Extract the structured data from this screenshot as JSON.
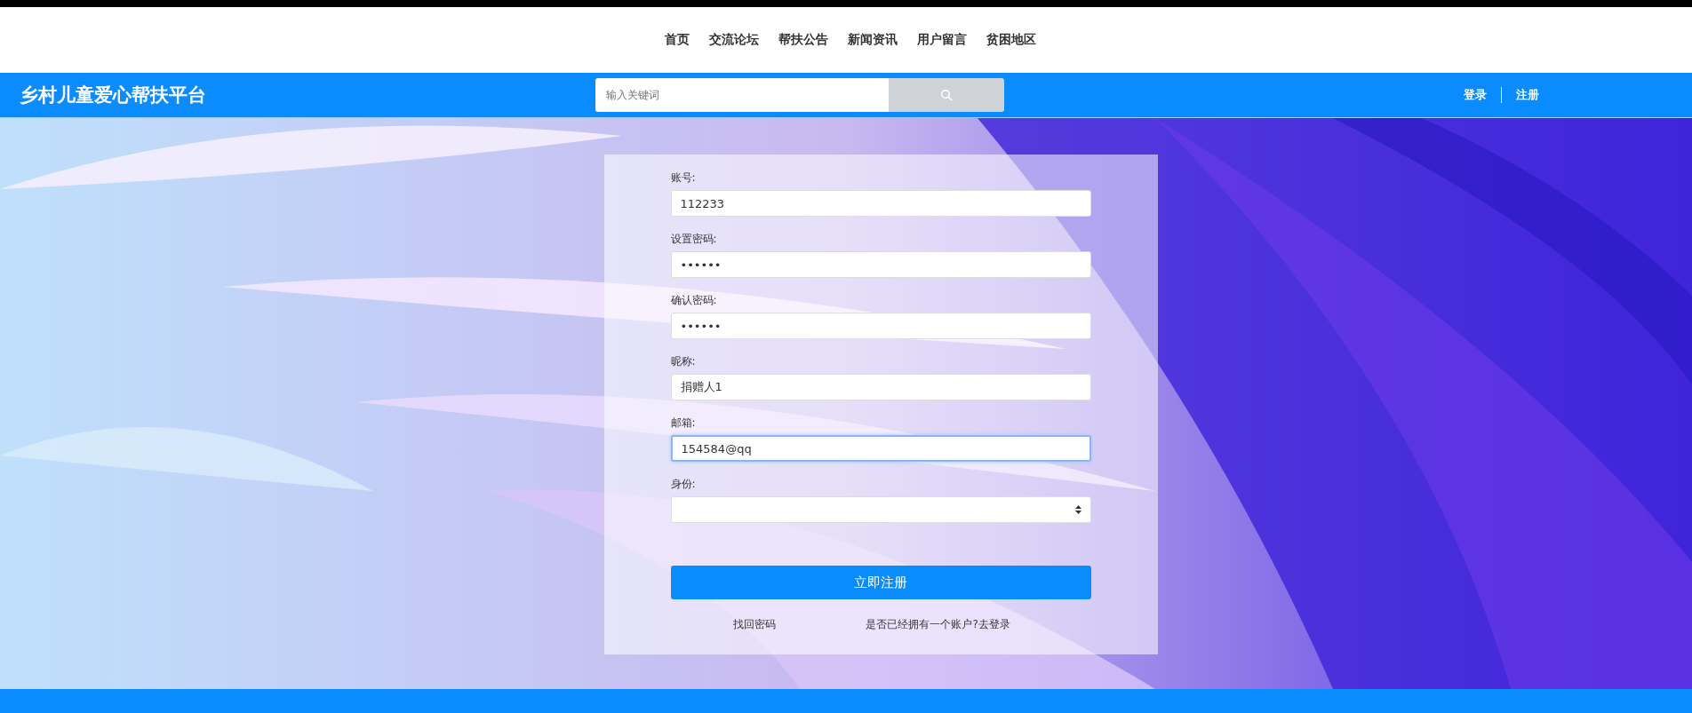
{
  "nav": [
    {
      "label": "首页"
    },
    {
      "label": "交流论坛"
    },
    {
      "label": "帮扶公告"
    },
    {
      "label": "新闻资讯"
    },
    {
      "label": "用户留言"
    },
    {
      "label": "贫困地区"
    }
  ],
  "header": {
    "title": "乡村儿童爱心帮扶平台",
    "search": {
      "placeholder": "输入关键词"
    },
    "links": [
      {
        "label": "登录"
      },
      {
        "label": "注册"
      }
    ]
  },
  "form": {
    "fields": [
      {
        "kind": "text",
        "label": "账号:",
        "value": "112233",
        "focused": false
      },
      {
        "kind": "text",
        "label": "设置密码:",
        "value": "••••••",
        "focused": false
      },
      {
        "kind": "text",
        "label": "确认密码:",
        "value": "••••••",
        "focused": false
      },
      {
        "kind": "text",
        "label": "昵称:",
        "value": "捐赠人1",
        "focused": false
      },
      {
        "kind": "text",
        "label": "邮箱:",
        "value": "154584@qq",
        "focused": true
      },
      {
        "kind": "select",
        "label": "身份:",
        "focused": false
      }
    ],
    "submit": "立即注册",
    "links": [
      {
        "label": "找回密码"
      },
      {
        "label": "是否已经拥有一个账户?去登录"
      }
    ]
  }
}
